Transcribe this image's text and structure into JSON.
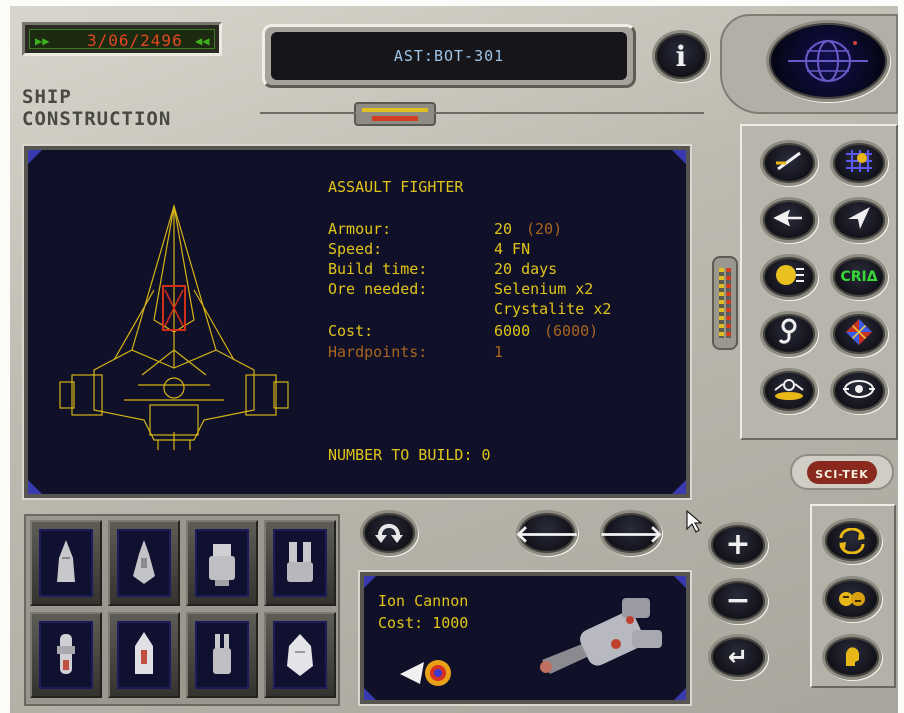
{
  "header": {
    "date": "3/06/2496",
    "location": "AST:BOT-301",
    "info_icon": "info-icon",
    "globe_icon": "globe-icon"
  },
  "screen": {
    "title_line1": "SHIP",
    "title_line2": "CONSTRUCTION"
  },
  "ship": {
    "name": "ASSAULT FIGHTER",
    "armour_label": "Armour:",
    "armour_value": "20",
    "armour_max": "(20)",
    "speed_label": "Speed:",
    "speed_value": "4 FN",
    "build_time_label": "Build time:",
    "build_time_value": "20 days",
    "ore_label": "Ore needed:",
    "ore_1": "Selenium x2",
    "ore_2": "Crystalite x2",
    "cost_label": "Cost:",
    "cost_value": "6000",
    "cost_max": "(6000)",
    "hardpoints_label": "Hardpoints:",
    "hardpoints_value": "1",
    "number_to_build_label": "NUMBER TO BUILD:",
    "number_to_build_value": "0"
  },
  "equipment": {
    "name": "Ion Cannon",
    "cost_label": "Cost:",
    "cost_value": "1000"
  },
  "side_buttons": [
    {
      "icon": "ship-launch-icon"
    },
    {
      "icon": "starmap-icon"
    },
    {
      "icon": "fleet-icon"
    },
    {
      "icon": "navigate-icon"
    },
    {
      "icon": "planet-icon"
    },
    {
      "icon": "cria-icon",
      "label": "CRIΔ"
    },
    {
      "icon": "hook-icon"
    },
    {
      "icon": "diamond-grid-icon"
    },
    {
      "icon": "research-icon"
    },
    {
      "icon": "eye-icon"
    }
  ],
  "brand": "SCI-TEK",
  "colors": {
    "panel_bg": "#101028",
    "text_yellow": "#e0c418",
    "text_dim": "#a8651e",
    "lcd_blue": "#9fc4e6",
    "metal": "#bdbbb0"
  }
}
